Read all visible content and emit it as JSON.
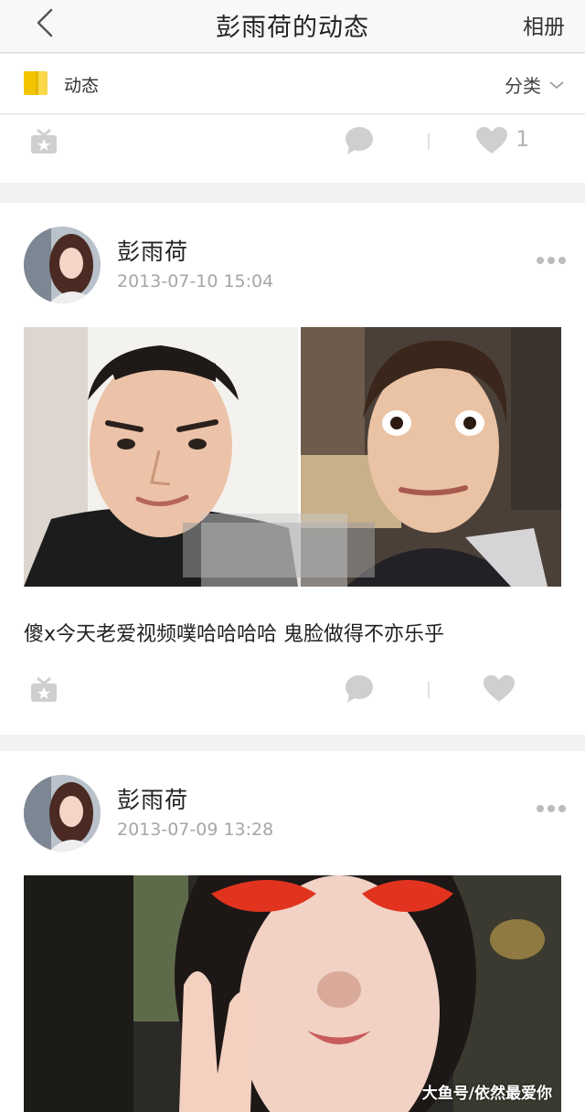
{
  "nav": {
    "title": "彭雨荷的动态",
    "album_label": "相册"
  },
  "filter": {
    "label": "动态",
    "category_label": "分类"
  },
  "prev_post": {
    "like_count": "1"
  },
  "posts": [
    {
      "author": "彭雨荷",
      "time": "2013-07-10 15:04",
      "caption": "傻x今天老爱视频噗哈哈哈哈 鬼脸做得不亦乐乎"
    },
    {
      "author": "彭雨荷",
      "time": "2013-07-09 13:28"
    }
  ],
  "watermark": "大鱼号/依然最爱你",
  "colors": {
    "icon_gray": "#cccccc",
    "accent_yellow": "#f5c400"
  }
}
